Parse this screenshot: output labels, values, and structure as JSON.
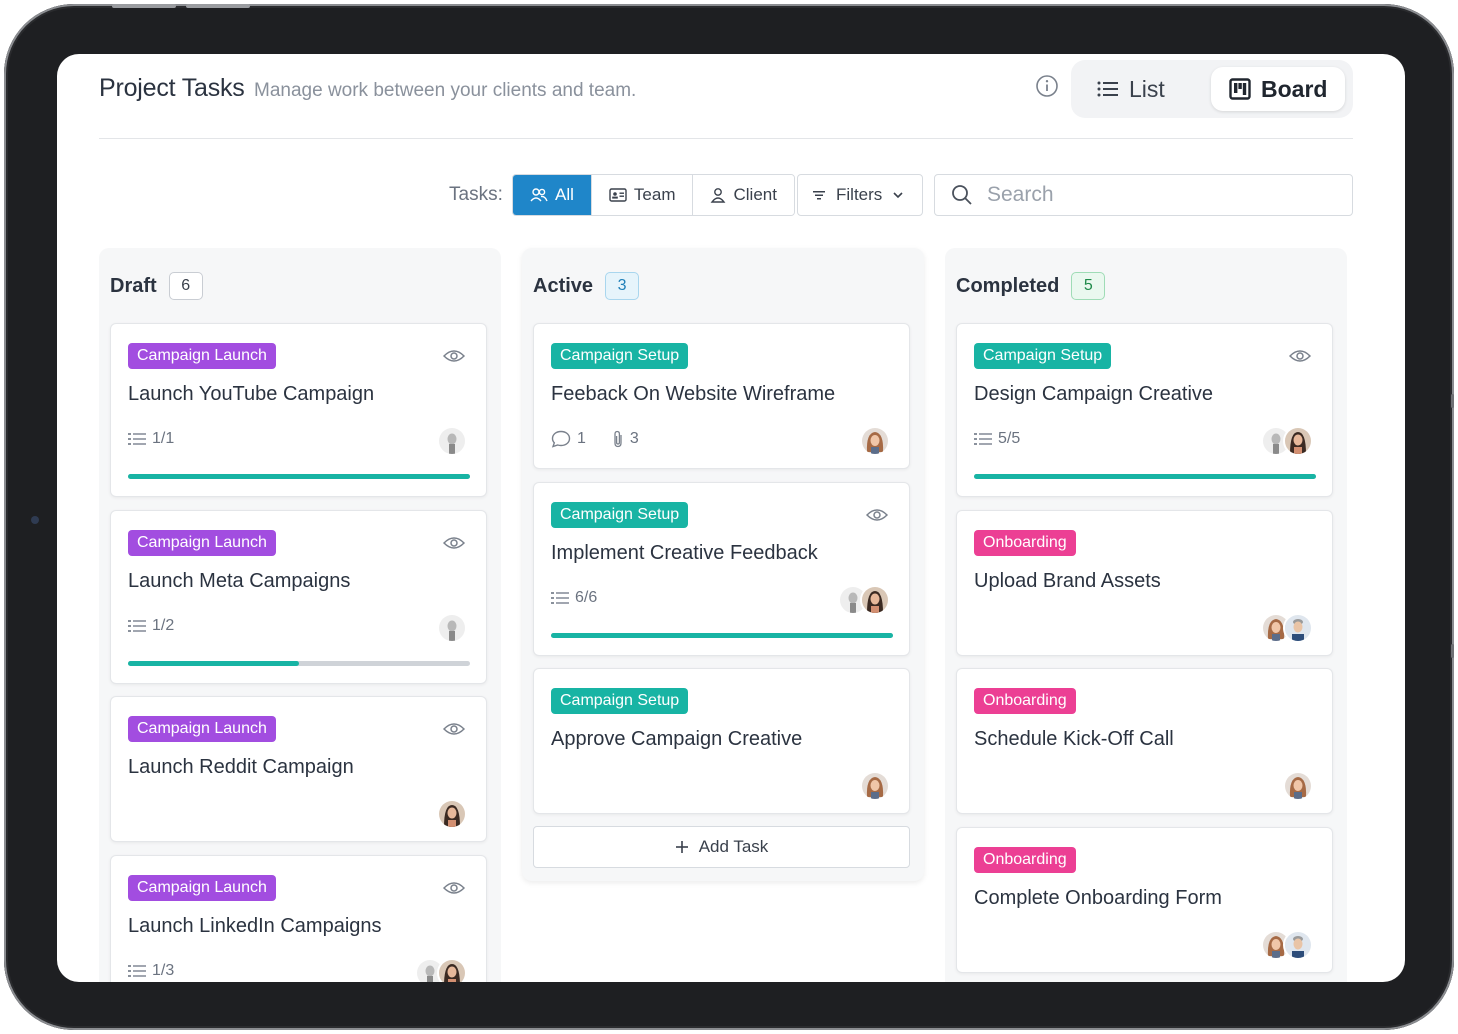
{
  "header": {
    "title": "Project Tasks",
    "subtitle": "Manage work between your clients and team.",
    "views": [
      {
        "label": "List",
        "icon": "list-icon",
        "active": false
      },
      {
        "label": "Board",
        "icon": "board-icon",
        "active": true
      }
    ]
  },
  "toolbar": {
    "tasks_label": "Tasks:",
    "segments": [
      {
        "label": "All",
        "icon": "users-icon",
        "active": true
      },
      {
        "label": "Team",
        "icon": "id-card-icon",
        "active": false
      },
      {
        "label": "Client",
        "icon": "user-icon",
        "active": false
      }
    ],
    "filters_label": "Filters",
    "search_placeholder": "Search"
  },
  "colors": {
    "accent": "#1f86c9",
    "tag_purple": "#a24de0",
    "tag_teal": "#18b4a4",
    "tag_pink": "#ec3f94",
    "progress": "#18b4a4"
  },
  "columns": [
    {
      "title": "Draft",
      "count": "6",
      "cards": [
        {
          "tag": "Campaign Launch",
          "title": "Launch YouTube Campaign",
          "checklist": "1/1",
          "progress": 1.0
        },
        {
          "tag": "Campaign Launch",
          "title": "Launch Meta Campaigns",
          "checklist": "1/2",
          "progress": 0.5
        },
        {
          "tag": "Campaign Launch",
          "title": "Launch Reddit Campaign"
        },
        {
          "tag": "Campaign Launch",
          "title": "Launch LinkedIn Campaigns",
          "checklist": "1/3"
        }
      ]
    },
    {
      "title": "Active",
      "count": "3",
      "cards": [
        {
          "tag": "Campaign Setup",
          "title": "Feeback On Website Wireframe",
          "comments": "1",
          "attachments": "3"
        },
        {
          "tag": "Campaign Setup",
          "title": "Implement Creative Feedback",
          "checklist": "6/6",
          "progress": 1.0
        },
        {
          "tag": "Campaign Setup",
          "title": "Approve Campaign Creative"
        }
      ],
      "add_task_label": "Add Task"
    },
    {
      "title": "Completed",
      "count": "5",
      "cards": [
        {
          "tag": "Campaign Setup",
          "title": "Design Campaign Creative",
          "checklist": "5/5",
          "progress": 1.0
        },
        {
          "tag": "Onboarding",
          "title": "Upload Brand Assets"
        },
        {
          "tag": "Onboarding",
          "title": "Schedule Kick-Off Call"
        },
        {
          "tag": "Onboarding",
          "title": "Complete Onboarding Form"
        }
      ]
    }
  ]
}
